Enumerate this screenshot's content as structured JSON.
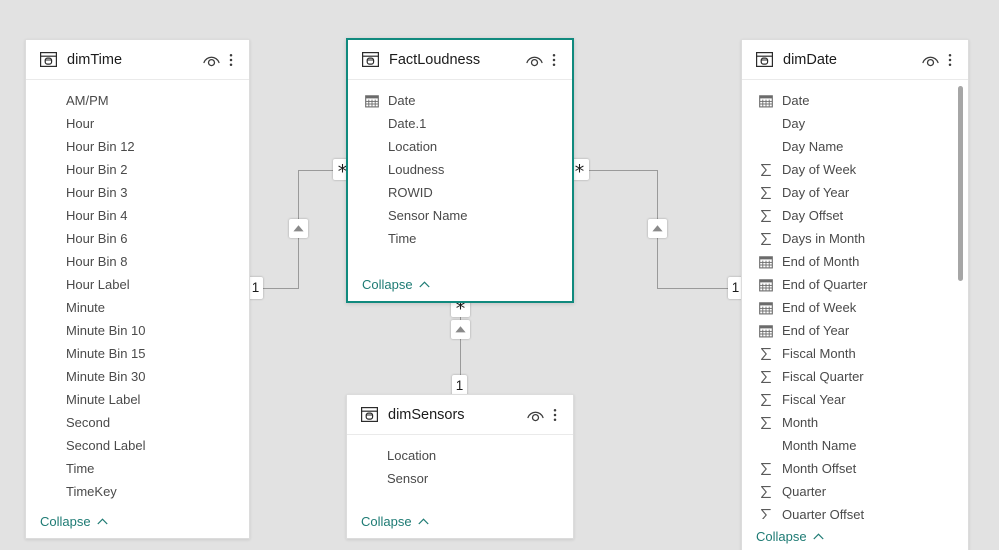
{
  "canvas": {
    "background_color": "#e2e2e2",
    "accent_color": "#118a7e",
    "link_color": "#1e7b74",
    "line_color": "#9a9a9a"
  },
  "tables": [
    {
      "id": "dimTime",
      "name": "dimTime",
      "selected": false,
      "collapse_label": "Collapse",
      "has_scrollbar": false,
      "fields": [
        {
          "label": "AM/PM",
          "icon": "none"
        },
        {
          "label": "Hour",
          "icon": "none"
        },
        {
          "label": "Hour Bin 12",
          "icon": "none"
        },
        {
          "label": "Hour Bin 2",
          "icon": "none"
        },
        {
          "label": "Hour Bin 3",
          "icon": "none"
        },
        {
          "label": "Hour Bin 4",
          "icon": "none"
        },
        {
          "label": "Hour Bin 6",
          "icon": "none"
        },
        {
          "label": "Hour Bin 8",
          "icon": "none"
        },
        {
          "label": "Hour Label",
          "icon": "none"
        },
        {
          "label": "Minute",
          "icon": "none"
        },
        {
          "label": "Minute Bin 10",
          "icon": "none"
        },
        {
          "label": "Minute Bin 15",
          "icon": "none"
        },
        {
          "label": "Minute Bin 30",
          "icon": "none"
        },
        {
          "label": "Minute Label",
          "icon": "none"
        },
        {
          "label": "Second",
          "icon": "none"
        },
        {
          "label": "Second Label",
          "icon": "none"
        },
        {
          "label": "Time",
          "icon": "none"
        },
        {
          "label": "TimeKey",
          "icon": "none"
        }
      ]
    },
    {
      "id": "FactLoudness",
      "name": "FactLoudness",
      "selected": true,
      "collapse_label": "Collapse",
      "has_scrollbar": false,
      "fields": [
        {
          "label": "Date",
          "icon": "calendar-icon"
        },
        {
          "label": "Date.1",
          "icon": "none"
        },
        {
          "label": "Location",
          "icon": "none"
        },
        {
          "label": "Loudness",
          "icon": "none"
        },
        {
          "label": "ROWID",
          "icon": "none"
        },
        {
          "label": "Sensor Name",
          "icon": "none"
        },
        {
          "label": "Time",
          "icon": "none"
        }
      ]
    },
    {
      "id": "dimDate",
      "name": "dimDate",
      "selected": false,
      "collapse_label": "Collapse",
      "has_scrollbar": true,
      "fields": [
        {
          "label": "Date",
          "icon": "calendar-icon"
        },
        {
          "label": "Day",
          "icon": "none"
        },
        {
          "label": "Day Name",
          "icon": "none"
        },
        {
          "label": "Day of Week",
          "icon": "sigma-icon"
        },
        {
          "label": "Day of Year",
          "icon": "sigma-icon"
        },
        {
          "label": "Day Offset",
          "icon": "sigma-icon"
        },
        {
          "label": "Days in Month",
          "icon": "sigma-icon"
        },
        {
          "label": "End of Month",
          "icon": "calendar-icon"
        },
        {
          "label": "End of Quarter",
          "icon": "calendar-icon"
        },
        {
          "label": "End of Week",
          "icon": "calendar-icon"
        },
        {
          "label": "End of Year",
          "icon": "calendar-icon"
        },
        {
          "label": "Fiscal Month",
          "icon": "sigma-icon"
        },
        {
          "label": "Fiscal Quarter",
          "icon": "sigma-icon"
        },
        {
          "label": "Fiscal Year",
          "icon": "sigma-icon"
        },
        {
          "label": "Month",
          "icon": "sigma-icon"
        },
        {
          "label": "Month Name",
          "icon": "none"
        },
        {
          "label": "Month Offset",
          "icon": "sigma-icon"
        },
        {
          "label": "Quarter",
          "icon": "sigma-icon"
        },
        {
          "label": "Quarter Offset",
          "icon": "sigma-icon"
        }
      ]
    },
    {
      "id": "dimSensors",
      "name": "dimSensors",
      "selected": false,
      "collapse_label": "Collapse",
      "has_scrollbar": false,
      "fields": [
        {
          "label": "Location",
          "icon": "none"
        },
        {
          "label": "Sensor",
          "icon": "none"
        }
      ]
    }
  ],
  "relationships": [
    {
      "id": "dimTime-FactLoudness",
      "from_table": "dimTime",
      "to_table": "FactLoudness",
      "from_cardinality": "1",
      "to_cardinality": "*",
      "cross_filter": "single"
    },
    {
      "id": "FactLoudness-dimDate",
      "from_table": "dimDate",
      "to_table": "FactLoudness",
      "from_cardinality": "1",
      "to_cardinality": "*",
      "cross_filter": "single"
    },
    {
      "id": "FactLoudness-dimSensors",
      "from_table": "dimSensors",
      "to_table": "FactLoudness",
      "from_cardinality": "1",
      "to_cardinality": "*",
      "cross_filter": "single"
    }
  ]
}
